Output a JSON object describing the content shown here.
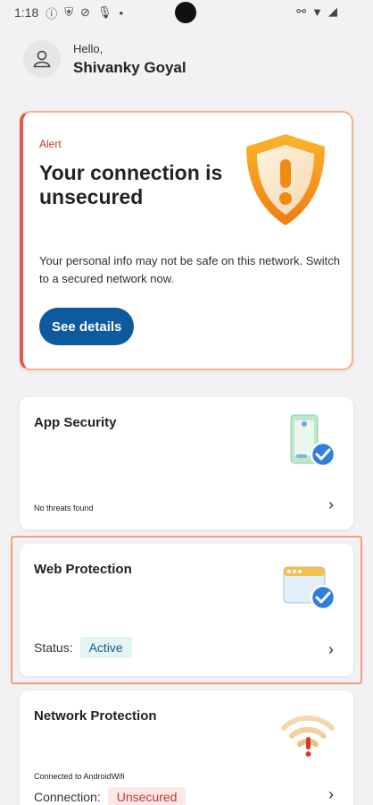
{
  "status_bar": {
    "time": "1:18"
  },
  "greeting": {
    "hello": "Hello,",
    "name": "Shivanky Goyal"
  },
  "alert": {
    "label": "Alert",
    "title": "Your connection is unsecured",
    "description": "Your personal info may not be safe on this network. Switch to a secured network now.",
    "button": "See details"
  },
  "app_security": {
    "title": "App Security",
    "status": "No threats found"
  },
  "web_protection": {
    "title": "Web Protection",
    "status_label": "Status:",
    "status_value": "Active"
  },
  "network_protection": {
    "title": "Network Protection",
    "connected_text": "Connected to AndroidWifi",
    "connection_label": "Connection:",
    "connection_value": "Unsecured"
  },
  "colors": {
    "accent": "#0e5a9e",
    "alert": "#c0392b",
    "warning": "#f29a1d"
  }
}
